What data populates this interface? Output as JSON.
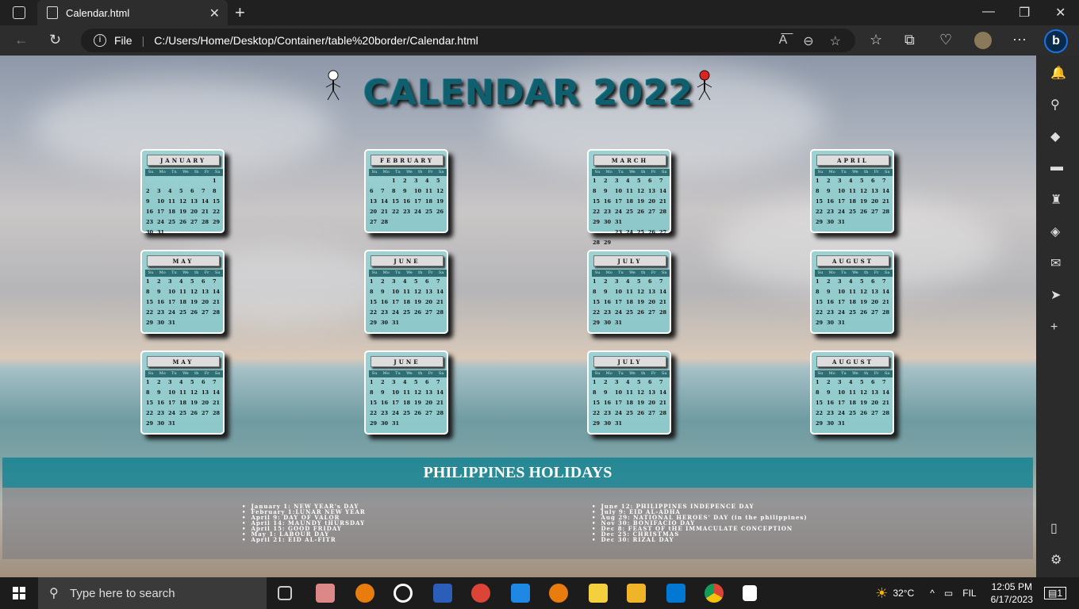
{
  "browser": {
    "tab_title": "Calendar.html",
    "url_label": "File",
    "url": "C:/Users/Home/Desktop/Container/table%20border/Calendar.html"
  },
  "page": {
    "title": "CALENDAR 2022",
    "holidays_title": "PHILIPPINES HOLIDAYS"
  },
  "weekdays": [
    "Su",
    "Mo",
    "Tu",
    "We",
    "th",
    "Fr",
    "Sa"
  ],
  "months": [
    {
      "name": "JANUARY",
      "days": [
        "",
        "",
        "",
        "",
        "",
        "",
        "1",
        "2",
        "3",
        "4",
        "5",
        "6",
        "7",
        "8",
        "9",
        "10",
        "11",
        "12",
        "13",
        "14",
        "15",
        "16",
        "17",
        "18",
        "19",
        "20",
        "21",
        "22",
        "23",
        "24",
        "25",
        "26",
        "27",
        "28",
        "29",
        "30",
        "31"
      ]
    },
    {
      "name": "FEBRUARY",
      "days": [
        "",
        "",
        "1",
        "2",
        "3",
        "4",
        "5",
        "6",
        "7",
        "8",
        "9",
        "10",
        "11",
        "12",
        "13",
        "14",
        "15",
        "16",
        "17",
        "18",
        "19",
        "20",
        "21",
        "22",
        "23",
        "24",
        "25",
        "26",
        "27",
        "28"
      ]
    },
    {
      "name": "MARCH",
      "days": [
        "1",
        "2",
        "3",
        "4",
        "5",
        "6",
        "7",
        "8",
        "9",
        "10",
        "11",
        "12",
        "13",
        "14",
        "15",
        "16",
        "17",
        "18",
        "19",
        "20",
        "21",
        "22",
        "23",
        "24",
        "25",
        "26",
        "27",
        "28",
        "29",
        "30",
        "31",
        "",
        "",
        "",
        "",
        "",
        "",
        "23",
        "24",
        "25",
        "26",
        "27",
        "28",
        "29"
      ]
    },
    {
      "name": "APRIL",
      "days": [
        "1",
        "2",
        "3",
        "4",
        "5",
        "6",
        "7",
        "8",
        "9",
        "10",
        "11",
        "12",
        "13",
        "14",
        "15",
        "16",
        "17",
        "18",
        "19",
        "20",
        "21",
        "22",
        "23",
        "24",
        "25",
        "26",
        "27",
        "28",
        "29",
        "30",
        "31"
      ]
    },
    {
      "name": "MAY",
      "days": [
        "1",
        "2",
        "3",
        "4",
        "5",
        "6",
        "7",
        "8",
        "9",
        "10",
        "11",
        "12",
        "13",
        "14",
        "15",
        "16",
        "17",
        "18",
        "19",
        "20",
        "21",
        "22",
        "23",
        "24",
        "25",
        "26",
        "27",
        "28",
        "29",
        "30",
        "31"
      ]
    },
    {
      "name": "JUNE",
      "days": [
        "1",
        "2",
        "3",
        "4",
        "5",
        "6",
        "7",
        "8",
        "9",
        "10",
        "11",
        "12",
        "13",
        "14",
        "15",
        "16",
        "17",
        "18",
        "19",
        "20",
        "21",
        "22",
        "23",
        "24",
        "25",
        "26",
        "27",
        "28",
        "29",
        "30",
        "31"
      ]
    },
    {
      "name": "JULY",
      "days": [
        "1",
        "2",
        "3",
        "4",
        "5",
        "6",
        "7",
        "8",
        "9",
        "10",
        "11",
        "12",
        "13",
        "14",
        "15",
        "16",
        "17",
        "18",
        "19",
        "20",
        "21",
        "22",
        "23",
        "24",
        "25",
        "26",
        "27",
        "28",
        "29",
        "30",
        "31"
      ]
    },
    {
      "name": "AUGUST",
      "days": [
        "1",
        "2",
        "3",
        "4",
        "5",
        "6",
        "7",
        "8",
        "9",
        "10",
        "11",
        "12",
        "13",
        "14",
        "15",
        "16",
        "17",
        "18",
        "19",
        "20",
        "21",
        "22",
        "23",
        "24",
        "25",
        "26",
        "27",
        "28",
        "29",
        "30",
        "31"
      ]
    },
    {
      "name": "MAY",
      "days": [
        "1",
        "2",
        "3",
        "4",
        "5",
        "6",
        "7",
        "8",
        "9",
        "10",
        "11",
        "12",
        "13",
        "14",
        "15",
        "16",
        "17",
        "18",
        "19",
        "20",
        "21",
        "22",
        "23",
        "24",
        "25",
        "26",
        "27",
        "28",
        "29",
        "30",
        "31"
      ]
    },
    {
      "name": "JUNE",
      "days": [
        "1",
        "2",
        "3",
        "4",
        "5",
        "6",
        "7",
        "8",
        "9",
        "10",
        "11",
        "12",
        "13",
        "14",
        "15",
        "16",
        "17",
        "18",
        "19",
        "20",
        "21",
        "22",
        "23",
        "24",
        "25",
        "26",
        "27",
        "28",
        "29",
        "30",
        "31"
      ]
    },
    {
      "name": "JULY",
      "days": [
        "1",
        "2",
        "3",
        "4",
        "5",
        "6",
        "7",
        "8",
        "9",
        "10",
        "11",
        "12",
        "13",
        "14",
        "15",
        "16",
        "17",
        "18",
        "19",
        "20",
        "21",
        "22",
        "23",
        "24",
        "25",
        "26",
        "27",
        "28",
        "29",
        "30",
        "31"
      ]
    },
    {
      "name": "AUGUST",
      "days": [
        "1",
        "2",
        "3",
        "4",
        "5",
        "6",
        "7",
        "8",
        "9",
        "10",
        "11",
        "12",
        "13",
        "14",
        "15",
        "16",
        "17",
        "18",
        "19",
        "20",
        "21",
        "22",
        "23",
        "24",
        "25",
        "26",
        "27",
        "28",
        "29",
        "30",
        "31"
      ]
    }
  ],
  "holidays_left": [
    "January 1: NEW YEAR's DAY",
    "February 1:LUNAR NEW YEAR",
    "April 9: DAY OF VALOR",
    "April 14: MAUNDY tHURSDAY",
    "April 15: GOOD FRIDAY",
    "May 1: LABOUR DAY",
    "April 21: EID AL-FITR"
  ],
  "holidays_right": [
    "June 12: PHILIPPINES INDEPENCE DAY",
    "July 9: EID AL-ADHA",
    "Aug 29: NATIONAL HEROES' DAY (in the philippines)",
    "Nov 30: BONIFACIO DAY",
    "Dec 8: FEAST OF tHE IMMACULATE CONCEPTION",
    "Dec 25: CHRISTMAS",
    "Dec 30: RIZAL DAY"
  ],
  "taskbar": {
    "search_placeholder": "Type here to search",
    "weather": "32°C",
    "language": "FIL",
    "time": "12:05 PM",
    "date": "6/17/2023",
    "notifications": "1"
  }
}
